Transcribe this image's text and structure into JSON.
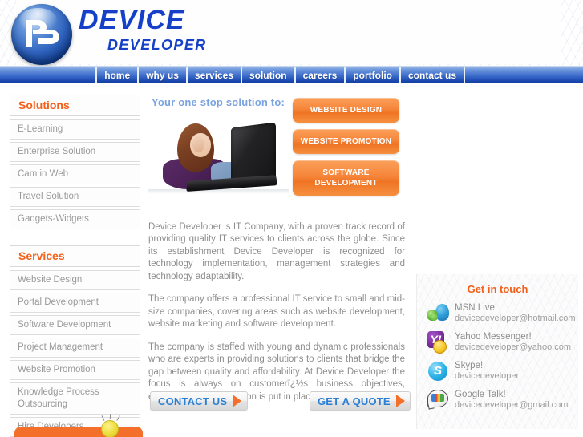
{
  "header": {
    "logo_icon": "dd-monogram-sphere-icon",
    "brand_line1": "DEVICE",
    "brand_line2": "DEVELOPER"
  },
  "nav": {
    "items": [
      {
        "label": "home"
      },
      {
        "label": "why us"
      },
      {
        "label": "services"
      },
      {
        "label": "solution"
      },
      {
        "label": "careers"
      },
      {
        "label": "portfolio"
      },
      {
        "label": "contact us"
      }
    ]
  },
  "sidebar": {
    "solutions": {
      "heading": "Solutions",
      "items": [
        {
          "label": "E-Learning"
        },
        {
          "label": "Enterprise Solution"
        },
        {
          "label": "Cam in Web"
        },
        {
          "label": "Travel Solution"
        },
        {
          "label": "Gadgets-Widgets"
        }
      ]
    },
    "services": {
      "heading": "Services",
      "items": [
        {
          "label": "Website Design"
        },
        {
          "label": "Portal Development"
        },
        {
          "label": "Software Development"
        },
        {
          "label": "Project Management"
        },
        {
          "label": "Website Promotion"
        },
        {
          "label": "Knowledge Process Outsourcing"
        },
        {
          "label": "Hire Developers"
        }
      ]
    }
  },
  "main": {
    "tagline": "Your one stop solution to:",
    "hero_image_alt": "woman-with-laptop-photo",
    "service_buttons": [
      {
        "label": "WEBSITE DESIGN"
      },
      {
        "label": "WEBSITE PROMOTION"
      },
      {
        "label": "SOFTWARE DEVELOPMENT"
      }
    ],
    "paragraphs": [
      "Device Developer is IT Company, with a proven track record of providing quality IT services to clients across the globe. Since its establishment Device Developer is recognized for technology implementation, management strategies and technology adaptability.",
      "The company offers a professional IT service to small and mid-size companies, covering areas such as website development, website marketing and software development.",
      "The company is staffed with young and dynamic professionals who are experts in providing solutions to clients that bridge the gap between quality and affordability. At Device Developer the focus is always on customerï¿½s business objectives, ensuring that right solution is put in place."
    ],
    "cta": {
      "contact_label": "CONTACT US",
      "quote_label": "GET A QUOTE"
    }
  },
  "get_in_touch": {
    "heading": "Get in touch",
    "contacts": [
      {
        "icon": "msn-messenger-icon",
        "name": "MSN Live!",
        "value": "devicedeveloper@hotmail.com"
      },
      {
        "icon": "yahoo-messenger-icon",
        "name": "Yahoo Messenger!",
        "value": "devicedeveloper@yahoo.com"
      },
      {
        "icon": "skype-icon",
        "name": "Skype!",
        "value": "devicedeveloper"
      },
      {
        "icon": "google-talk-icon",
        "name": "Google Talk!",
        "value": "devicedeveloper@gmail.com"
      }
    ]
  },
  "colors": {
    "brand_blue": "#1640c8",
    "nav_blue": "#3f6fcc",
    "accent_orange": "#f4601a",
    "button_orange": "#ef7424",
    "link_blue": "#2a7fd4",
    "body_text_gray": "#8e8e8e",
    "tagline_blue": "#7aa3e0"
  }
}
